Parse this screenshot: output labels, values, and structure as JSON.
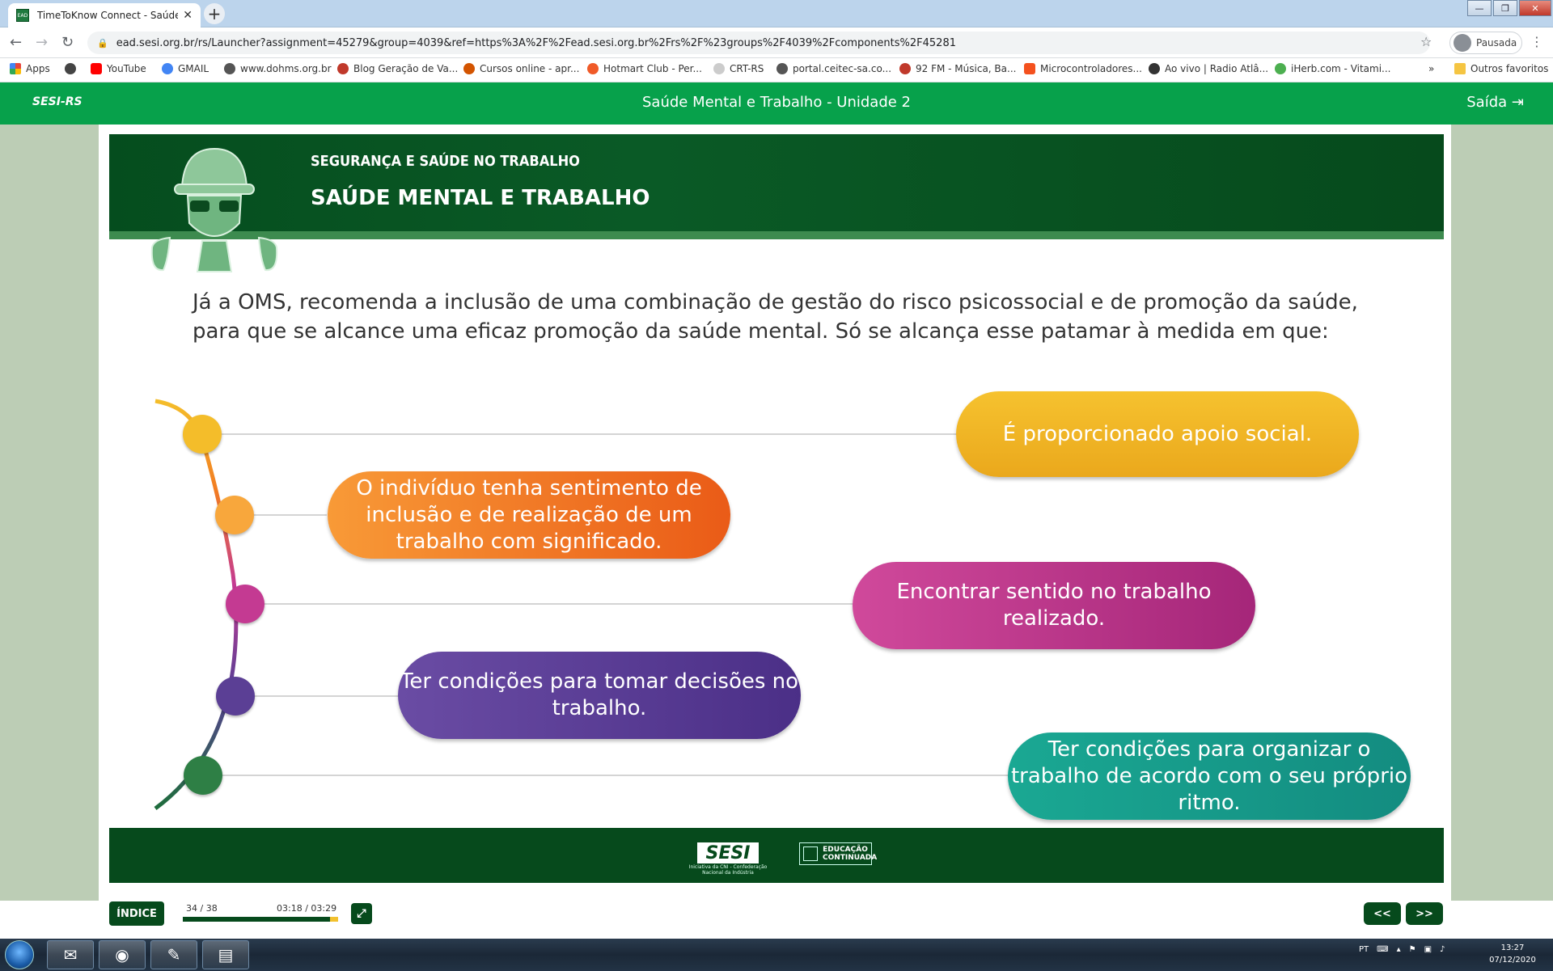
{
  "browser": {
    "tab_title": "TimeToKnow Connect - Saúde M",
    "favicon_text": "EAD",
    "url": "ead.sesi.org.br/rs/Launcher?assignment=45279&group=4039&ref=https%3A%2F%2Fead.sesi.org.br%2Frs%2F%23groups%2F4039%2Fcomponents%2F45281",
    "profile_label": "Pausada",
    "bookmarks": [
      {
        "label": "Apps",
        "color": "#e8453c"
      },
      {
        "label": "",
        "color": "#444444"
      },
      {
        "label": "YouTube",
        "color": "#ff0000"
      },
      {
        "label": "GMAIL",
        "color": "#4285f4"
      },
      {
        "label": "www.dohms.org.br",
        "color": "#555555"
      },
      {
        "label": "Blog Geração de Va...",
        "color": "#c0392b"
      },
      {
        "label": "Cursos online - apr...",
        "color": "#d35400"
      },
      {
        "label": "Hotmart Club - Per...",
        "color": "#f05a28"
      },
      {
        "label": "CRT-RS",
        "color": "#cccccc"
      },
      {
        "label": "portal.ceitec-sa.co...",
        "color": "#555555"
      },
      {
        "label": "92 FM - Música, Ba...",
        "color": "#c0392b"
      },
      {
        "label": "Microcontroladores...",
        "color": "#f4511e"
      },
      {
        "label": "Ao vivo | Radio Atlâ...",
        "color": "#333333"
      },
      {
        "label": "iHerb.com - Vitami...",
        "color": "#4caf50"
      }
    ],
    "bookmarks_overflow": "»",
    "other_favorites": "Outros favoritos"
  },
  "app": {
    "brand": "SESI-RS",
    "title": "Saúde Mental e Trabalho - Unidade 2",
    "exit_label": "Saída"
  },
  "banner": {
    "subtitle": "SEGURANÇA E SAÚDE NO TRABALHO",
    "title": "SAÚDE MENTAL E TRABALHO"
  },
  "content": {
    "intro": "Já a OMS, recomenda a inclusão de uma combinação de gestão do risco psicossocial e de promoção da saúde, para que se alcance uma eficaz promoção da saúde mental. Só se alcança esse patamar à medida em que:",
    "items": [
      {
        "text": "É proporcionado apoio social.",
        "color": "#f4bd2a"
      },
      {
        "text": "O indivíduo tenha sentimento de inclusão e de realização de um trabalho com significado.",
        "color": "#f27c22"
      },
      {
        "text": "Encontrar sentido no trabalho realizado.",
        "color": "#c43a92"
      },
      {
        "text": "Ter condições para tomar decisões no trabalho.",
        "color": "#5b3f95"
      },
      {
        "text": "Ter condições para organizar o trabalho de acordo com o seu próprio ritmo.",
        "color": "#159a8e"
      }
    ]
  },
  "footer": {
    "sesi_logo": "SESI",
    "sesi_caption": "Iniciativa da CNI - Confederação Nacional da Indústria",
    "educ_label": "EDUCAÇÃO CONTINUADA"
  },
  "player": {
    "index_label": "ÍNDICE",
    "page_counter": "34 / 38",
    "time": "03:18 / 03:29",
    "progress_fraction": 0.948,
    "prev_label": "<<",
    "next_label": ">>"
  },
  "taskbar": {
    "language": "PT",
    "time": "13:27",
    "date": "07/12/2020"
  }
}
